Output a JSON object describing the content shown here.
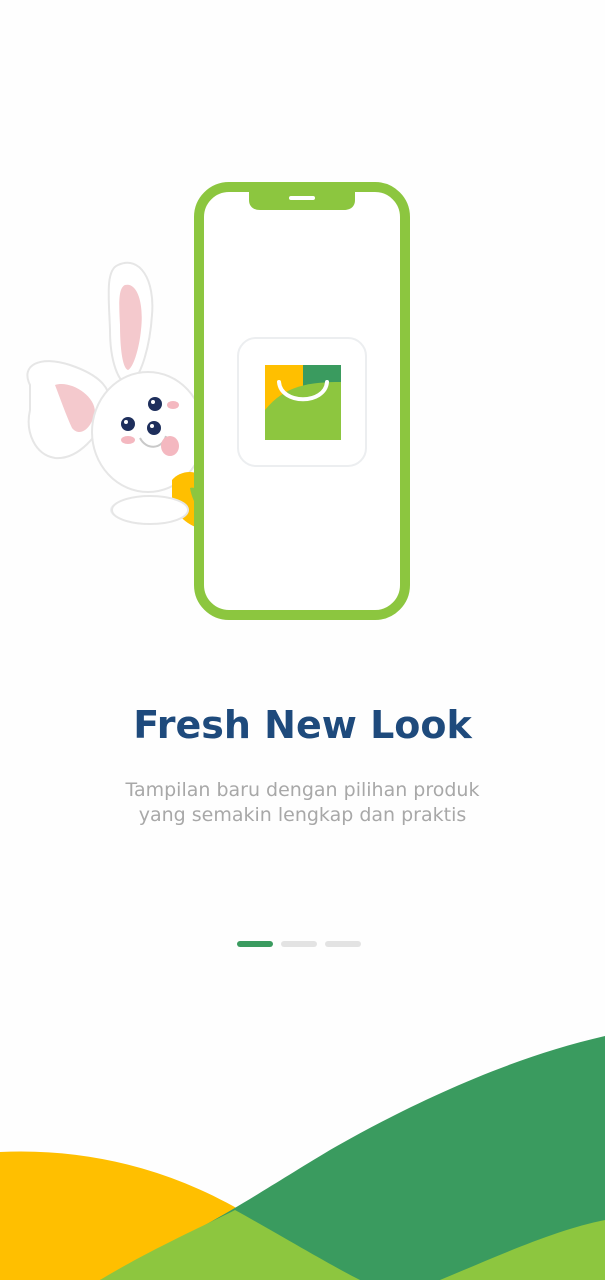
{
  "onboarding": {
    "title": "Fresh New Look",
    "subtitle_lines": [
      "Tampilan baru dengan pilihan produk",
      "yang semakin lengkap dan praktis"
    ],
    "pager": {
      "total": 3,
      "active_index": 0
    }
  },
  "illustration": {
    "mascot": "bunny-mascot",
    "device": "smartphone-outline",
    "app_logo": "shopping-bag-logo"
  },
  "colors": {
    "title": "#1e4a7c",
    "subtitle": "#a8a8a8",
    "phone_frame": "#8cc63f",
    "brand_green_dark": "#3a9b5f",
    "brand_green_light": "#8dc63f",
    "brand_yellow": "#ffbf00",
    "pager_active": "#3a9b5f",
    "pager_inactive": "#e3e3e3"
  }
}
